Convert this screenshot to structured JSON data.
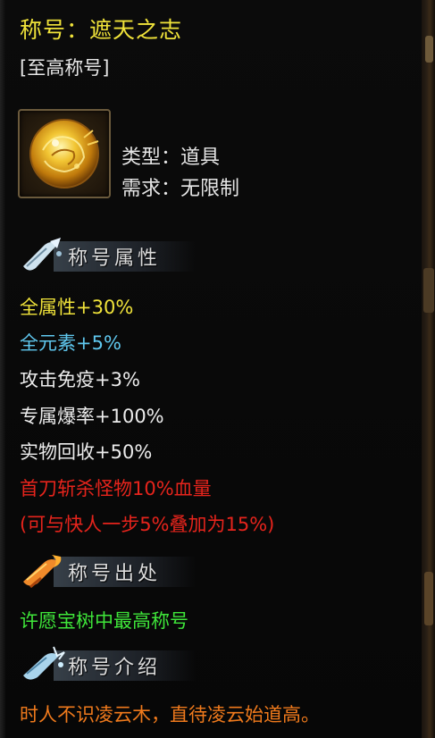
{
  "tooltip": {
    "title": "称号：遮天之志",
    "subtitle": "[至高称号]",
    "item_icon": "golden-medallion-icon",
    "type": "类型：道具",
    "requirement": "需求：无限制",
    "sections": {
      "attributes": {
        "label": "称号属性",
        "icon": "scroll-icon",
        "lines": [
          {
            "text": "全属性+30%",
            "color": "#f0e33a"
          },
          {
            "text": "全元素+5%",
            "color": "#5fc7ee"
          },
          {
            "text": "攻击免疫+3%",
            "color": "#ececec"
          },
          {
            "text": "专属爆率+100%",
            "color": "#ececec"
          },
          {
            "text": "实物回收+50%",
            "color": "#ececec"
          },
          {
            "text": "首刀斩杀怪物10%血量",
            "color": "#e6241c"
          },
          {
            "text": "(可与快人一步5%叠加为15%)",
            "color": "#e6241c"
          }
        ]
      },
      "source": {
        "label": "称号出处",
        "icon": "flame-scroll-icon",
        "text": "许愿宝树中最高称号",
        "color": "#3fe63a"
      },
      "intro": {
        "label": "称号介绍",
        "icon": "ice-scroll-icon",
        "text": "时人不识凌云木，直待凌云始道高。",
        "color": "#f07a1c"
      }
    }
  }
}
